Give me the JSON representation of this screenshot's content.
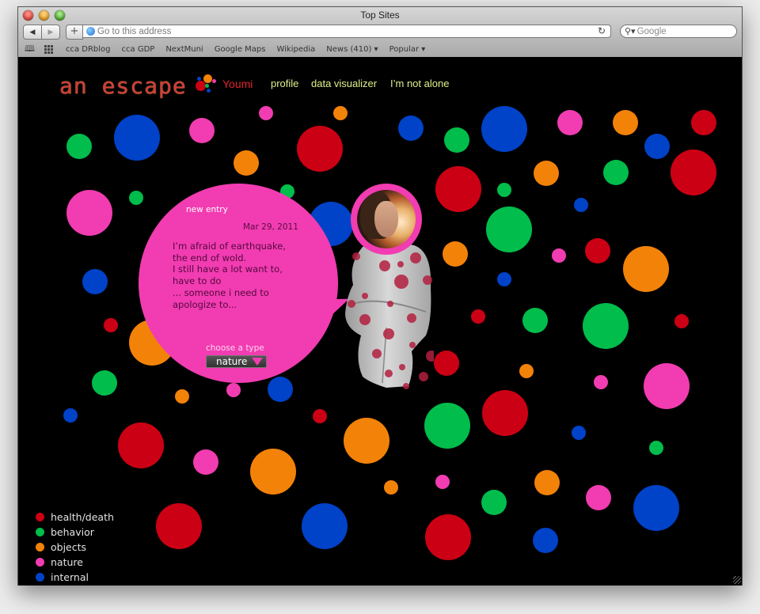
{
  "browser": {
    "window_title": "Top Sites",
    "address_placeholder": "Go to this address",
    "search_placeholder": "Google",
    "back_glyph": "◀",
    "forward_glyph": "▶",
    "add_glyph": "+",
    "reload_glyph": "↻",
    "search_glyph": "⚲▾",
    "bookmarks": [
      {
        "label": "cca DRblog"
      },
      {
        "label": "cca GDP"
      },
      {
        "label": "NextMuni"
      },
      {
        "label": "Google Maps"
      },
      {
        "label": "Wikipedia"
      },
      {
        "label": "News (410) ▾"
      },
      {
        "label": "Popular ▾"
      }
    ]
  },
  "page": {
    "logo": "an escape",
    "user": "Youmi",
    "nav": [
      "profile",
      "data visualizer",
      "I’m not alone"
    ],
    "colors": {
      "health_death": "#cc0014",
      "behavior": "#00bd4c",
      "objects": "#f38208",
      "nature": "#f23cb1",
      "internal": "#0042c8",
      "nav_text": "#dff08a",
      "user_text": "#e4232d"
    }
  },
  "entry": {
    "heading": "new entry",
    "date": "Mar 29, 2011",
    "text": "I’m afraid of earthquake,\nthe end of wold.\nI still have a lot want to,\nhave to do\n... someone i need to\napologize to...",
    "type_label": "choose a type",
    "type_value": "nature"
  },
  "legend": [
    {
      "key": "health_death",
      "label": "health/death"
    },
    {
      "key": "behavior",
      "label": "behavior"
    },
    {
      "key": "objects",
      "label": "objects"
    },
    {
      "key": "nature",
      "label": "nature"
    },
    {
      "key": "internal",
      "label": "internal"
    }
  ],
  "entries_by_category": {
    "health_death": 14,
    "behavior": 13,
    "objects": 13,
    "nature": 12,
    "internal": 13
  }
}
